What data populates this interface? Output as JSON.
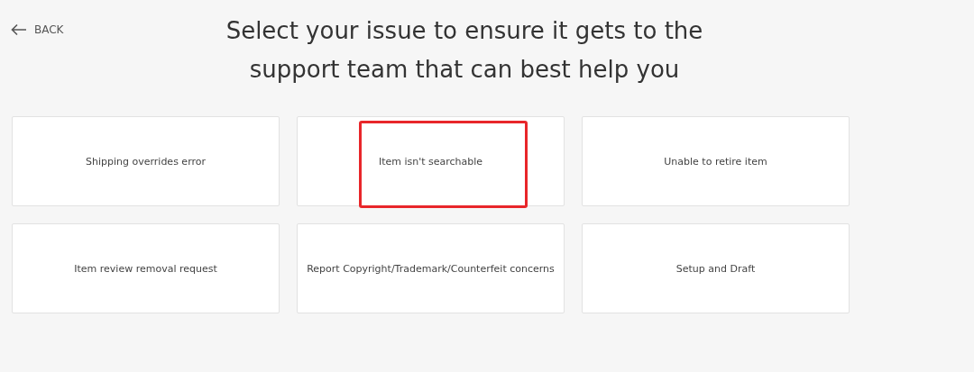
{
  "back": {
    "label": "BACK"
  },
  "title": "Select your issue to ensure it gets to the support team that can best help you",
  "issues": [
    {
      "label": "Shipping overrides error",
      "annotated": false
    },
    {
      "label": "Item isn't searchable",
      "annotated": true
    },
    {
      "label": "Unable to retire item",
      "annotated": false
    },
    {
      "label": "Item review removal request",
      "annotated": false
    },
    {
      "label": "Report Copyright/Trademark/Counterfeit concerns",
      "annotated": false
    },
    {
      "label": "Setup and Draft",
      "annotated": false
    }
  ]
}
